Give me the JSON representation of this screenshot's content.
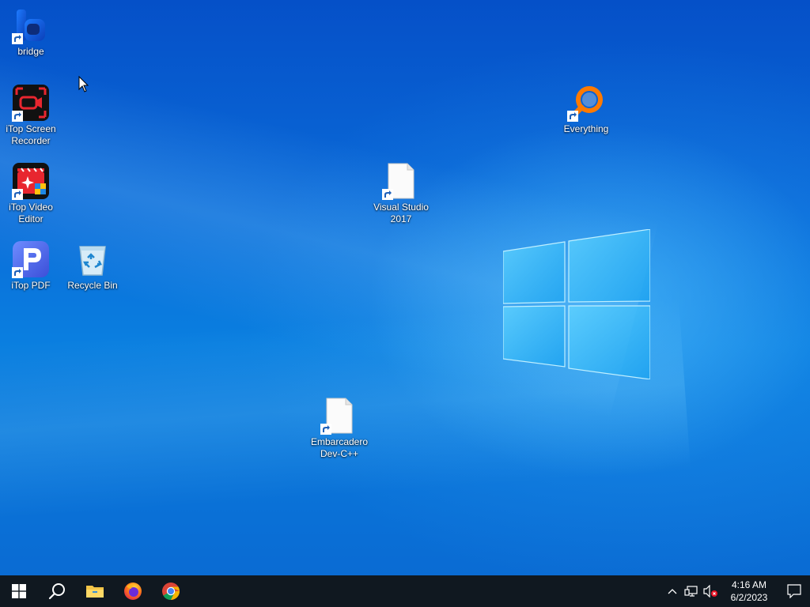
{
  "desktop": {
    "icons": [
      {
        "label": "bridge",
        "icon": "bridge-app-icon",
        "shortcut": true
      },
      {
        "label": "iTop Screen Recorder",
        "icon": "itop-screen-recorder-icon",
        "shortcut": true
      },
      {
        "label": "iTop Video Editor",
        "icon": "itop-video-editor-icon",
        "shortcut": true
      },
      {
        "label": "iTop PDF",
        "icon": "itop-pdf-icon",
        "shortcut": true
      },
      {
        "label": "Recycle Bin",
        "icon": "recycle-bin-icon",
        "shortcut": false
      },
      {
        "label": "Visual Studio 2017",
        "icon": "blank-file-icon",
        "shortcut": true
      },
      {
        "label": "Everything",
        "icon": "everything-search-icon",
        "shortcut": true
      },
      {
        "label": "Embarcadero Dev-C++",
        "icon": "blank-file-icon",
        "shortcut": true
      }
    ]
  },
  "taskbar": {
    "start": "start-icon",
    "search": "search-icon",
    "pinned": [
      "file-explorer-icon",
      "firefox-icon",
      "chrome-icon"
    ],
    "tray": {
      "icons": [
        "chevron-up-icon",
        "network-icon",
        "volume-muted-icon"
      ],
      "time": "4:16 AM",
      "date": "6/2/2023",
      "notifications": "notifications-icon"
    }
  },
  "colors": {
    "taskbar_bg": "#101820",
    "desktop_blue": "#0a74d6",
    "everything_orange": "#ff7a00",
    "itop_red": "#e8262f",
    "itop_pdf_blue": "#4a6cf7"
  }
}
